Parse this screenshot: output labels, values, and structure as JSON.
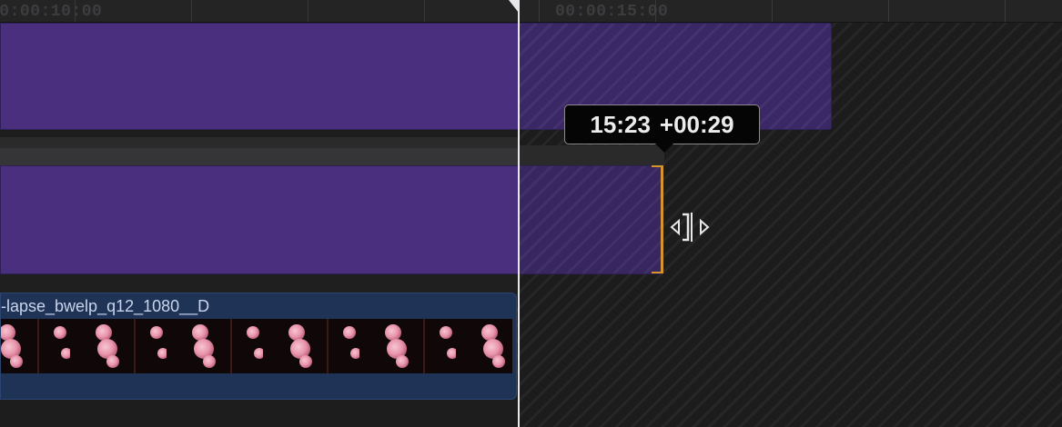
{
  "ruler": {
    "timecode_left": "00:00:10:00",
    "timecode_right": "00:00:15:00"
  },
  "tooltip": {
    "timecode": "15:23",
    "delta": "+00:29"
  },
  "video_clip": {
    "name": "-lapse_bwelp_q12_1080__D"
  },
  "colors": {
    "title_clip": "#4a2f7f",
    "video_clip": "#1e3356",
    "trim_handle": "#d4952a",
    "playhead": "#e8e8ea",
    "background": "#1a1a1b"
  },
  "icons": {
    "trim_cursor": "ripple-trim-cursor-icon",
    "playhead_marker": "playhead-flag-icon"
  }
}
